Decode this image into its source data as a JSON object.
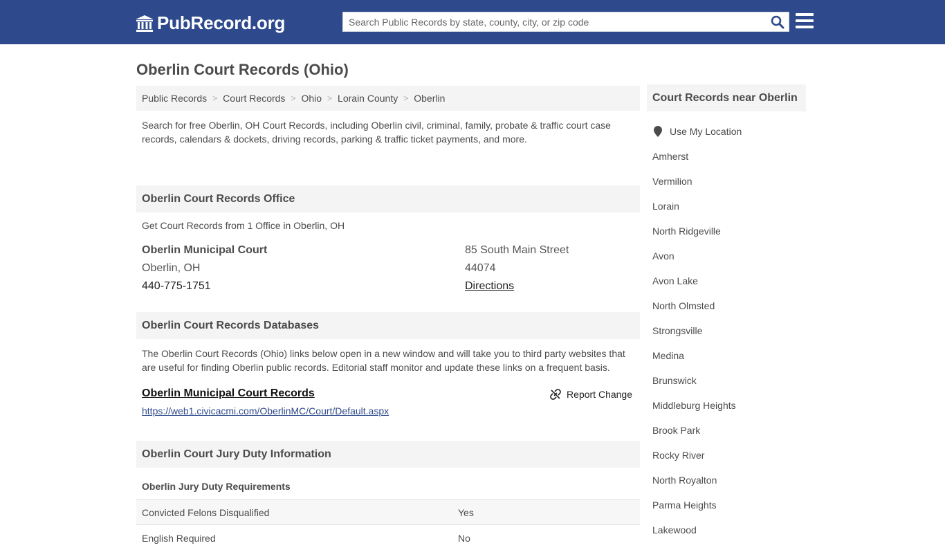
{
  "header": {
    "logo_text": "PubRecord.org",
    "search_placeholder": "Search Public Records by state, county, city, or zip code"
  },
  "page": {
    "title": "Oberlin Court Records (Ohio)"
  },
  "breadcrumb": [
    "Public Records",
    "Court Records",
    "Ohio",
    "Lorain County",
    "Oberlin"
  ],
  "intro": "Search for free Oberlin, OH Court Records, including Oberlin civil, criminal, family, probate & traffic court case records, calendars & dockets, driving records, parking & traffic ticket payments, and more.",
  "office_section": {
    "heading": "Oberlin Court Records Office",
    "note": "Get Court Records from 1 Office in Oberlin, OH",
    "office": {
      "name": "Oberlin Municipal Court",
      "city": "Oberlin, OH",
      "phone": "440-775-1751",
      "street": "85 South Main Street",
      "zip": "44074",
      "directions": "Directions"
    }
  },
  "databases_section": {
    "heading": "Oberlin Court Records Databases",
    "description": "The Oberlin Court Records (Ohio) links below open in a new window and will take you to third party websites that are useful for finding Oberlin public records. Editorial staff monitor and update these links on a frequent basis.",
    "item": {
      "title": "Oberlin Municipal Court Records",
      "url": "https://web1.civicacmi.com/OberlinMC/Court/Default.aspx",
      "report_label": "Report Change"
    }
  },
  "jury_section": {
    "heading": "Oberlin Court Jury Duty Information",
    "subheading": "Oberlin Jury Duty Requirements",
    "rows": [
      {
        "label": "Convicted Felons Disqualified",
        "value": "Yes"
      },
      {
        "label": "English Required",
        "value": "No"
      }
    ]
  },
  "sidebar": {
    "heading": "Court Records near Oberlin",
    "use_location": "Use My Location",
    "places": [
      "Amherst",
      "Vermilion",
      "Lorain",
      "North Ridgeville",
      "Avon",
      "Avon Lake",
      "North Olmsted",
      "Strongsville",
      "Medina",
      "Brunswick",
      "Middleburg Heights",
      "Brook Park",
      "Rocky River",
      "North Royalton",
      "Parma Heights",
      "Lakewood"
    ]
  },
  "colors": {
    "header_bg": "#2e4a8c",
    "section_bg": "#f4f4f4",
    "text": "#4b4b4b"
  }
}
